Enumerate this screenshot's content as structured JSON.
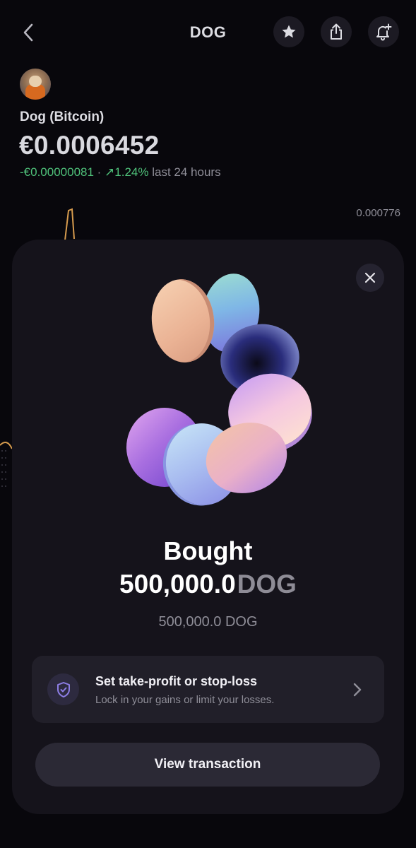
{
  "header": {
    "title": "DOG",
    "back_icon": "chevron-left-icon",
    "actions": [
      "star-icon",
      "share-icon",
      "bell-plus-icon"
    ]
  },
  "asset": {
    "name": "Dog (Bitcoin)",
    "price": "€0.0006452",
    "change_amount": "-€0.00000081",
    "change_separator": " · ",
    "change_arrow": "↗",
    "change_percent": "1.24%",
    "change_period": "last 24 hours",
    "chart_max_label": "0.000776"
  },
  "modal": {
    "title": "Bought",
    "amount_value": "500,000.0",
    "amount_symbol": "DOG",
    "amount_sub": "500,000.0 DOG",
    "take_profit": {
      "title": "Set take-profit or stop-loss",
      "subtitle": "Lock in your gains or limit your losses."
    },
    "view_button_label": "View transaction"
  },
  "colors": {
    "background": "#08070c",
    "sheet": "#15131b",
    "positive": "#4fc17a",
    "accent_purple": "#8d7ee6"
  }
}
